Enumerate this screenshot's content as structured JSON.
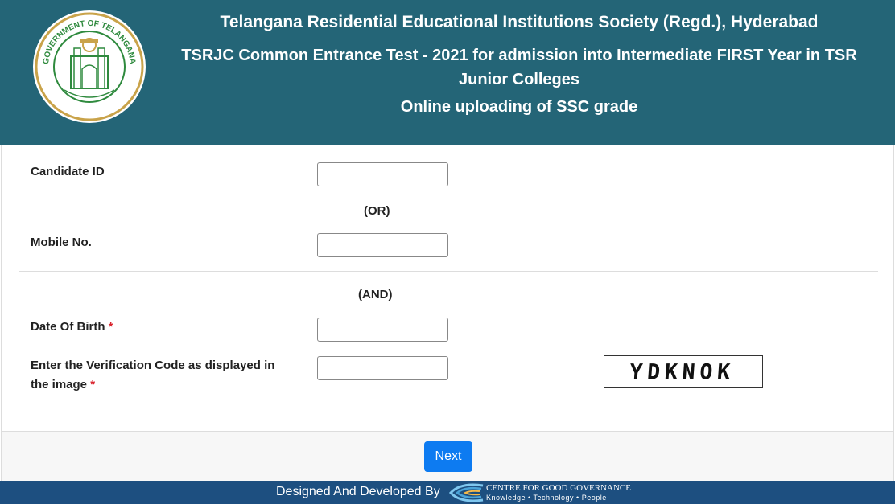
{
  "header": {
    "title_line1": "Telangana Residential Educational Institutions Society (Regd.), Hyderabad",
    "title_line2": "TSRJC Common Entrance Test - 2021 for admission into Intermediate FIRST Year in TSR Junior Colleges",
    "title_line3": "Online uploading of SSC grade",
    "logo_text_top": "GOVERNMENT OF TELANGANA"
  },
  "form": {
    "candidate_id_label": "Candidate ID",
    "candidate_id_value": "",
    "or_text": "(OR)",
    "mobile_label": "Mobile No.",
    "mobile_value": "",
    "and_text": "(AND)",
    "dob_label": "Date Of Birth",
    "dob_value": "",
    "verification_label": "Enter the Verification Code as displayed in the image",
    "verification_value": "",
    "required_mark": "*",
    "captcha_text": "YDKNOK"
  },
  "actions": {
    "next_label": "Next"
  },
  "footer": {
    "credit_text": "Designed And Developed By",
    "org_name": "CENTRE FOR GOOD GOVERNANCE",
    "org_tagline": "Knowledge • Technology • People"
  },
  "colors": {
    "header_bg": "#246577",
    "button_bg": "#0d7bf1",
    "footer_bg": "#1d4f80",
    "required": "#d9232d"
  }
}
